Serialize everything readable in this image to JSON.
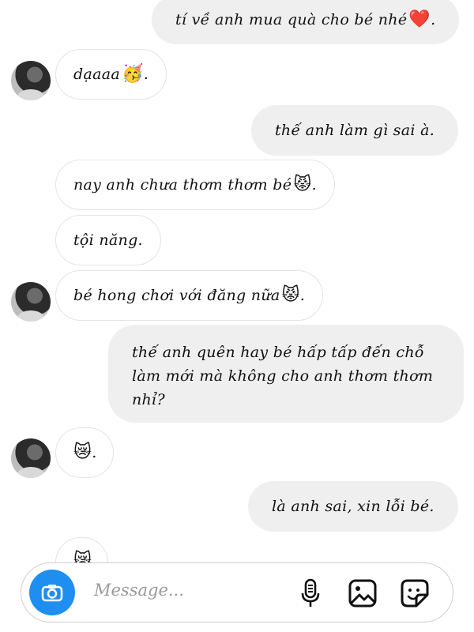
{
  "messages": [
    {
      "side": "out",
      "text": "tí về anh mua quà cho bé nhé",
      "emoji": "❤️",
      "tail": "."
    },
    {
      "side": "in",
      "text": "dạaaa",
      "emoji": "🥳",
      "tail": "."
    },
    {
      "side": "out",
      "text": "thế anh làm gì sai à."
    },
    {
      "side": "in",
      "text": "nay anh chưa thơm thơm bé",
      "emoji": "😾",
      "tail": "."
    },
    {
      "side": "in",
      "text": "tội năng."
    },
    {
      "side": "in",
      "text": "bé hong chơi với đăng nữa",
      "emoji": "😾",
      "tail": "."
    },
    {
      "side": "out",
      "text": "thế anh quên hay bé hấp tấp đến chỗ làm mới mà không cho anh thơm thơm nhỉ?"
    },
    {
      "side": "in",
      "text": "",
      "emoji": "😿",
      "tail": "."
    },
    {
      "side": "out",
      "text": "là anh sai, xin lỗi bé."
    },
    {
      "side": "in",
      "text": "",
      "emoji": "😿",
      "tail": ""
    }
  ],
  "composer": {
    "placeholder": "Message...",
    "icons": [
      "camera-icon",
      "microphone-icon",
      "gallery-icon",
      "sticker-icon"
    ]
  },
  "colors": {
    "outgoing_bubble": "#efefef",
    "incoming_border": "#e4e4e4",
    "camera_button": "#1f8ef1"
  }
}
